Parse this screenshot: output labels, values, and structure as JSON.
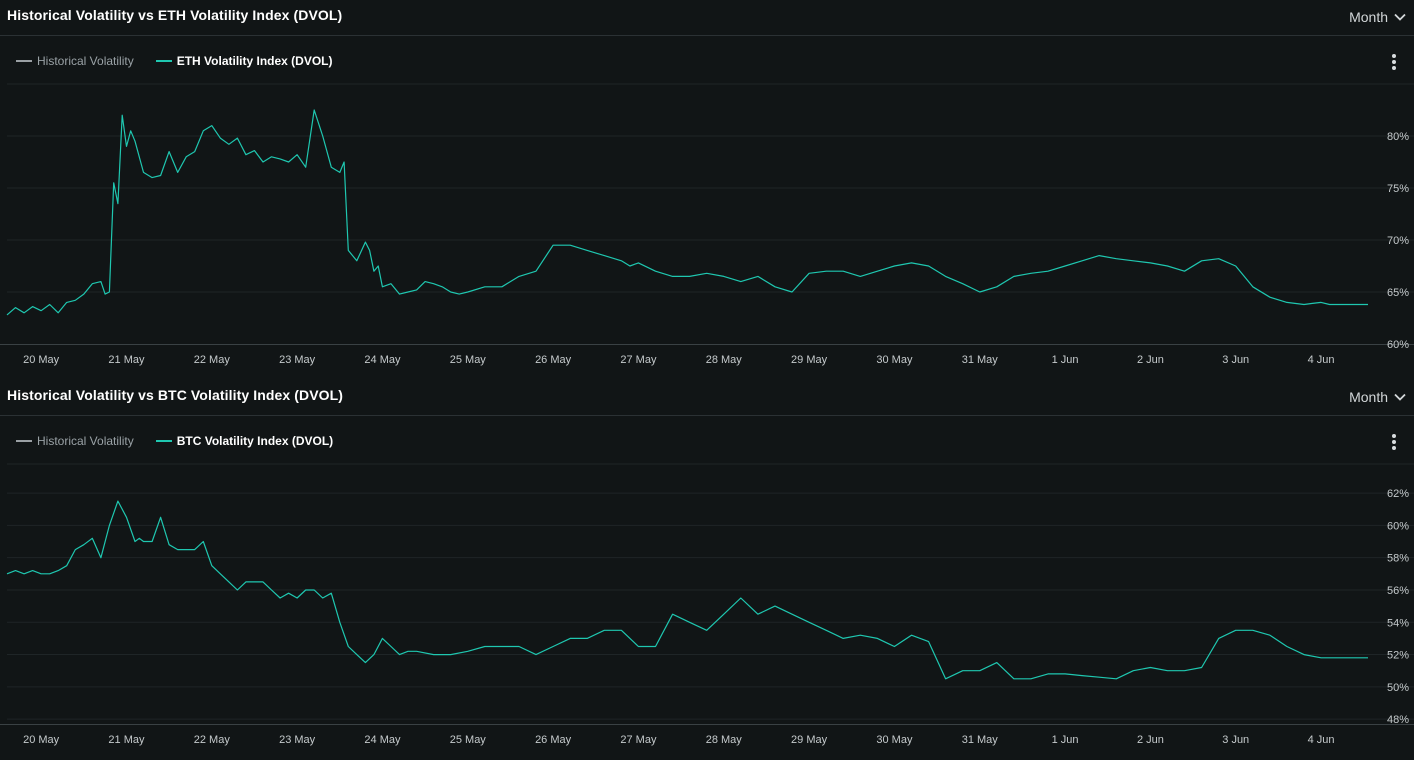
{
  "panels": [
    {
      "title": "Historical Volatility vs ETH Volatility Index (DVOL)",
      "period": "Month",
      "legend": [
        {
          "label": "Historical Volatility",
          "color": "#9aa0a4",
          "active": false
        },
        {
          "label": "ETH Volatility Index (DVOL)",
          "color": "#1fc7b0",
          "active": true
        }
      ]
    },
    {
      "title": "Historical Volatility vs BTC Volatility Index (DVOL)",
      "period": "Month",
      "legend": [
        {
          "label": "Historical Volatility",
          "color": "#9aa0a4",
          "active": false
        },
        {
          "label": "BTC Volatility Index (DVOL)",
          "color": "#1fc7b0",
          "active": true
        }
      ]
    }
  ],
  "chart_data": [
    {
      "type": "line",
      "title": "Historical Volatility vs ETH Volatility Index (DVOL)",
      "x_tick_labels": [
        "20 May",
        "21 May",
        "22 May",
        "23 May",
        "24 May",
        "25 May",
        "26 May",
        "27 May",
        "28 May",
        "29 May",
        "30 May",
        "31 May",
        "1 Jun",
        "2 Jun",
        "3 Jun",
        "4 Jun"
      ],
      "y_tick_labels": [
        "80%",
        "75%",
        "70%",
        "65%",
        "60%"
      ],
      "y_ticks": [
        80,
        75,
        70,
        65,
        60
      ],
      "xlim": [
        19.6,
        35.55
      ],
      "ylim": [
        60,
        85
      ],
      "grid": true,
      "legend_position": "top-left",
      "series": [
        {
          "name": "ETH Volatility Index (DVOL)",
          "color": "#1fc7b0",
          "x": [
            19.6,
            19.7,
            19.8,
            19.9,
            20.0,
            20.1,
            20.2,
            20.3,
            20.4,
            20.5,
            20.6,
            20.7,
            20.75,
            20.8,
            20.85,
            20.9,
            20.95,
            21.0,
            21.05,
            21.1,
            21.2,
            21.3,
            21.4,
            21.5,
            21.6,
            21.7,
            21.8,
            21.9,
            22.0,
            22.1,
            22.2,
            22.3,
            22.4,
            22.5,
            22.6,
            22.7,
            22.8,
            22.9,
            23.0,
            23.1,
            23.2,
            23.3,
            23.4,
            23.5,
            23.55,
            23.6,
            23.7,
            23.8,
            23.85,
            23.9,
            23.95,
            24.0,
            24.1,
            24.2,
            24.3,
            24.4,
            24.5,
            24.6,
            24.7,
            24.8,
            24.9,
            25.0,
            25.2,
            25.4,
            25.6,
            25.8,
            26.0,
            26.2,
            26.4,
            26.6,
            26.8,
            26.9,
            27.0,
            27.2,
            27.4,
            27.6,
            27.8,
            28.0,
            28.2,
            28.4,
            28.6,
            28.8,
            29.0,
            29.2,
            29.4,
            29.6,
            29.8,
            30.0,
            30.2,
            30.4,
            30.6,
            30.8,
            31.0,
            31.2,
            31.4,
            31.6,
            31.8,
            32.0,
            32.2,
            32.4,
            32.6,
            32.8,
            33.0,
            33.2,
            33.4,
            33.6,
            33.8,
            34.0,
            34.2,
            34.4,
            34.6,
            34.8,
            34.9,
            35.0,
            35.1,
            35.3,
            35.55
          ],
          "y": [
            62.8,
            63.5,
            63.0,
            63.6,
            63.2,
            63.8,
            63.0,
            64.0,
            64.2,
            64.8,
            65.8,
            66.0,
            64.8,
            65.0,
            75.5,
            73.5,
            82.0,
            79.0,
            80.5,
            79.5,
            76.5,
            76.0,
            76.2,
            78.5,
            76.5,
            78.0,
            78.5,
            80.5,
            81.0,
            79.8,
            79.2,
            79.8,
            78.2,
            78.6,
            77.5,
            78.0,
            77.8,
            77.5,
            78.2,
            77.0,
            82.5,
            80.0,
            77.0,
            76.5,
            77.5,
            69.0,
            68.0,
            69.8,
            69.0,
            67.0,
            67.5,
            65.5,
            65.8,
            64.8,
            65.0,
            65.2,
            66.0,
            65.8,
            65.5,
            65.0,
            64.8,
            65.0,
            65.5,
            65.5,
            66.5,
            67.0,
            69.5,
            69.5,
            69.0,
            68.5,
            68.0,
            67.5,
            67.8,
            67.0,
            66.5,
            66.5,
            66.8,
            66.5,
            66.0,
            66.5,
            65.5,
            65.0,
            66.8,
            67.0,
            67.0,
            66.5,
            67.0,
            67.5,
            67.8,
            67.5,
            66.5,
            65.8,
            65.0,
            65.5,
            66.5,
            66.8,
            67.0,
            67.5,
            68.0,
            68.5,
            68.2,
            68.0,
            67.8,
            67.5,
            67.0,
            68.0,
            68.2,
            67.5,
            65.5,
            64.5,
            64.0,
            63.8,
            63.9,
            64.0,
            63.8,
            63.8,
            63.8
          ]
        }
      ]
    },
    {
      "type": "line",
      "title": "Historical Volatility vs BTC Volatility Index (DVOL)",
      "x_tick_labels": [
        "20 May",
        "21 May",
        "22 May",
        "23 May",
        "24 May",
        "25 May",
        "26 May",
        "27 May",
        "28 May",
        "29 May",
        "30 May",
        "31 May",
        "1 Jun",
        "2 Jun",
        "3 Jun",
        "4 Jun"
      ],
      "y_tick_labels": [
        "62%",
        "60%",
        "58%",
        "56%",
        "54%",
        "52%",
        "50%",
        "48%"
      ],
      "y_ticks": [
        62,
        60,
        58,
        56,
        54,
        52,
        50,
        48
      ],
      "xlim": [
        19.6,
        35.55
      ],
      "ylim": [
        47.7,
        63.8
      ],
      "grid": true,
      "legend_position": "top-left",
      "series": [
        {
          "name": "BTC Volatility Index (DVOL)",
          "color": "#1fc7b0",
          "x": [
            19.6,
            19.7,
            19.8,
            19.9,
            20.0,
            20.1,
            20.2,
            20.3,
            20.4,
            20.5,
            20.6,
            20.7,
            20.8,
            20.9,
            21.0,
            21.1,
            21.15,
            21.2,
            21.3,
            21.4,
            21.5,
            21.6,
            21.7,
            21.8,
            21.9,
            22.0,
            22.1,
            22.2,
            22.3,
            22.4,
            22.5,
            22.6,
            22.7,
            22.8,
            22.9,
            23.0,
            23.1,
            23.2,
            23.3,
            23.4,
            23.5,
            23.6,
            23.7,
            23.8,
            23.9,
            24.0,
            24.1,
            24.2,
            24.3,
            24.4,
            24.6,
            24.8,
            25.0,
            25.2,
            25.4,
            25.6,
            25.8,
            26.0,
            26.2,
            26.4,
            26.6,
            26.8,
            27.0,
            27.2,
            27.4,
            27.6,
            27.8,
            28.0,
            28.2,
            28.4,
            28.6,
            28.8,
            29.0,
            29.2,
            29.4,
            29.6,
            29.8,
            30.0,
            30.2,
            30.4,
            30.6,
            30.8,
            31.0,
            31.2,
            31.4,
            31.6,
            31.8,
            32.0,
            32.2,
            32.4,
            32.6,
            32.8,
            33.0,
            33.2,
            33.4,
            33.6,
            33.8,
            34.0,
            34.2,
            34.4,
            34.6,
            34.8,
            35.0,
            35.2,
            35.4,
            35.55
          ],
          "y": [
            57.0,
            57.2,
            57.0,
            57.2,
            57.0,
            57.0,
            57.2,
            57.5,
            58.5,
            58.8,
            59.2,
            58.0,
            60.0,
            61.5,
            60.5,
            59.0,
            59.2,
            59.0,
            59.0,
            60.5,
            58.8,
            58.5,
            58.5,
            58.5,
            59.0,
            57.5,
            57.0,
            56.5,
            56.0,
            56.5,
            56.5,
            56.5,
            56.0,
            55.5,
            55.8,
            55.5,
            56.0,
            56.0,
            55.5,
            55.8,
            54.0,
            52.5,
            52.0,
            51.5,
            52.0,
            53.0,
            52.5,
            52.0,
            52.2,
            52.2,
            52.0,
            52.0,
            52.2,
            52.5,
            52.5,
            52.5,
            52.0,
            52.5,
            53.0,
            53.0,
            53.5,
            53.5,
            52.5,
            52.5,
            54.5,
            54.0,
            53.5,
            54.5,
            55.5,
            54.5,
            55.0,
            54.5,
            54.0,
            53.5,
            53.0,
            53.2,
            53.0,
            52.5,
            53.2,
            52.8,
            50.5,
            51.0,
            51.0,
            51.5,
            50.5,
            50.5,
            50.8,
            50.8,
            50.7,
            50.6,
            50.5,
            51.0,
            51.2,
            51.0,
            51.0,
            51.2,
            53.0,
            53.5,
            53.5,
            53.2,
            52.5,
            52.0,
            51.8,
            51.8,
            51.8,
            51.8
          ]
        }
      ]
    }
  ]
}
